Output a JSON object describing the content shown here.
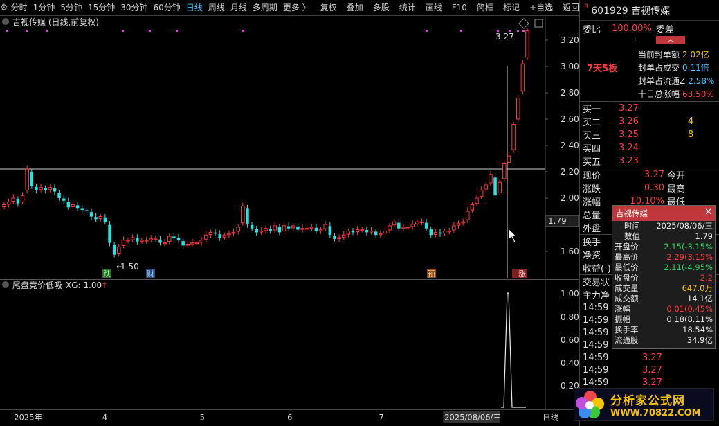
{
  "toolbar": {
    "gear_icon": "gear-icon",
    "period_tabs": [
      "分时",
      "1分钟",
      "5分钟",
      "15分钟",
      "30分钟",
      "60分钟",
      "日线",
      "周线",
      "月线",
      "多周期",
      "更多 〉"
    ],
    "active_tab": "日线",
    "tools": [
      "复权",
      "叠加",
      "多股",
      "统计",
      "画线",
      "F10",
      "简框",
      "标记",
      "+自选",
      "返回"
    ]
  },
  "main_chart": {
    "title": "吉视传媒 (日线,前复权)",
    "y_ticks": [
      "3.20",
      "3.00",
      "2.80",
      "2.60",
      "2.40",
      "2.20",
      "2.00",
      "1.79",
      "1.60"
    ],
    "cursor_price": "1.79",
    "low_label": "1.50",
    "high_label": "3.27",
    "markers": [
      "跌",
      "财",
      "预",
      "涨"
    ]
  },
  "sub_chart": {
    "title": "尾盘竞价低吸",
    "xg_label": "XG: 1.00",
    "y_ticks": [
      "1.00",
      "0.80",
      "0.60",
      "0.40",
      "0.20"
    ]
  },
  "date_axis": {
    "labels": [
      "2025年",
      "4",
      "5",
      "6",
      "7",
      "2025/08/06/三"
    ],
    "period": "日线"
  },
  "right_panel": {
    "code_name": "601929 吉视传媒",
    "weibi_label": "委比",
    "weibi_value": "100.00%",
    "weicha_label": "委差",
    "lianban": "7天5板",
    "seal_rows": [
      {
        "k": "当前封单额",
        "v": "2.02亿",
        "color": "#f5c400"
      },
      {
        "k": "封单占成交",
        "v": "0.11倍",
        "color": "#44c4ff"
      },
      {
        "k": "封单占流通Z",
        "v": "2.58%",
        "color": "#44c4ff"
      },
      {
        "k": "十日总涨幅",
        "v": "63.50%",
        "color": "#ff3b3b"
      }
    ],
    "bids": [
      {
        "k": "买一",
        "v": "3.27",
        "vol": ""
      },
      {
        "k": "买二",
        "v": "3.26",
        "vol": "4"
      },
      {
        "k": "买三",
        "v": "3.25",
        "vol": "8"
      },
      {
        "k": "买四",
        "v": "3.24",
        "vol": ""
      },
      {
        "k": "买五",
        "v": "3.23",
        "vol": ""
      }
    ],
    "quote": [
      {
        "k": "现价",
        "v": "3.27",
        "k2": "今开"
      },
      {
        "k": "涨跌",
        "v": "0.30",
        "k2": "最高"
      },
      {
        "k": "涨幅",
        "v": "10.10%",
        "k2": "最低"
      },
      {
        "k": "总量",
        "v": "",
        "k2": ""
      },
      {
        "k": "外盘",
        "v": "",
        "k2": ""
      }
    ],
    "more": [
      "换手",
      "净资",
      "收益(-)"
    ],
    "sections": [
      "交易状",
      "主力净"
    ],
    "ticks": [
      {
        "t": "14:59",
        "p": ""
      },
      {
        "t": "14:59",
        "p": ""
      },
      {
        "t": "14:59",
        "p": ""
      },
      {
        "t": "14:59",
        "p": ""
      },
      {
        "t": "14:59",
        "p": "3.27"
      },
      {
        "t": "14:59",
        "p": "3.27"
      },
      {
        "t": "14:59",
        "p": "3.27"
      }
    ]
  },
  "popup": {
    "title": "吉视传媒",
    "rows": [
      {
        "k": "时间",
        "v": "2025/08/06/三",
        "color": "#e8e8e8"
      },
      {
        "k": "数值",
        "v": "1.79",
        "color": "#e8e8e8"
      },
      {
        "k": "开盘价",
        "v": "2.15(-3.15%",
        "color": "#2fd35a"
      },
      {
        "k": "最高价",
        "v": "2.29(3.15%",
        "color": "#ff3b3b"
      },
      {
        "k": "最低价",
        "v": "2.11(-4.95%",
        "color": "#2fd35a"
      },
      {
        "k": "收盘价",
        "v": "2.2",
        "color": "#ff3b3b"
      },
      {
        "k": "成交量",
        "v": "647.0万",
        "color": "#f5c400"
      },
      {
        "k": "成交额",
        "v": "14.1亿",
        "color": "#e8e8e8"
      },
      {
        "k": "涨幅",
        "v": "0.01(0.45%",
        "color": "#ff3b3b"
      },
      {
        "k": "振幅",
        "v": "0.18(8.11%",
        "color": "#e8e8e8"
      },
      {
        "k": "换手率",
        "v": "18.54%",
        "color": "#e8e8e8"
      },
      {
        "k": "流通股",
        "v": "34.9亿",
        "color": "#e8e8e8"
      }
    ]
  },
  "watermark": {
    "line1": "分析家公式网",
    "line2": "WWW.70822.COM"
  },
  "colors": {
    "up": "#ff3b3b",
    "down": "#2fe0e0",
    "active_tab": "#44c4ff",
    "popup_title_bg": "#c0373b"
  }
}
